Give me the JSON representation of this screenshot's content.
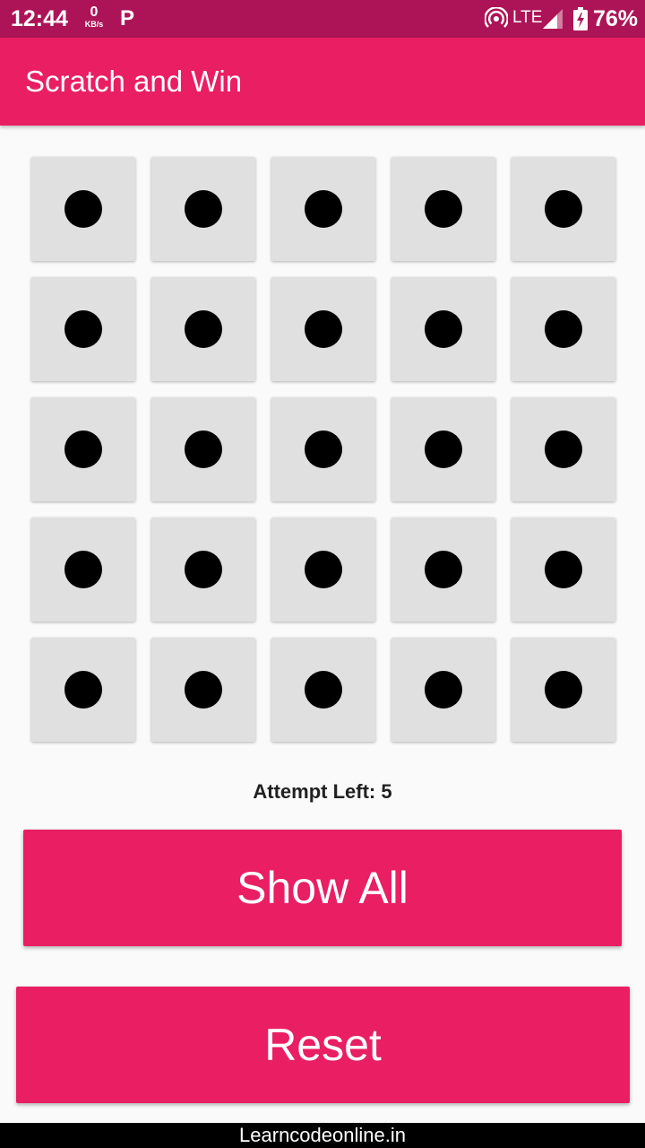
{
  "status_bar": {
    "time": "12:44",
    "net_speed_value": "0",
    "net_speed_unit": "KB/s",
    "app_icon_letter": "P",
    "network_label": "LTE",
    "battery": "76%"
  },
  "app_bar": {
    "title": "Scratch and Win"
  },
  "grid": {
    "rows": 5,
    "columns": 5,
    "tile_icon": "circle-icon"
  },
  "attempts": {
    "text": "Attempt Left: 5"
  },
  "buttons": {
    "show_all": "Show All",
    "reset": "Reset"
  },
  "watermark": "Learncodeonline.in",
  "colors": {
    "primary": "#e91e63",
    "primary_dark": "#ad1457",
    "tile": "#e0e0e0",
    "background": "#fafafa"
  }
}
